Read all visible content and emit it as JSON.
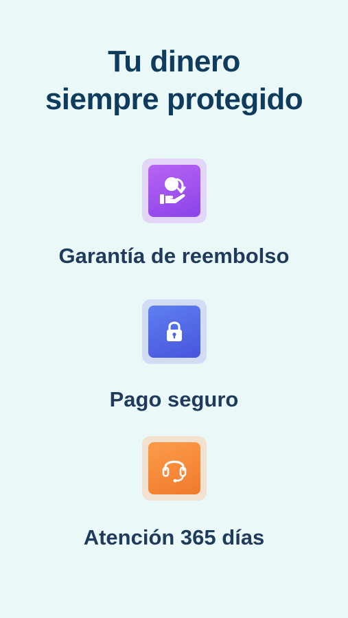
{
  "header": {
    "title_line1": "Tu dinero",
    "title_line2": "siempre protegido"
  },
  "features": [
    {
      "icon": "refund-hand-icon",
      "label": "Garantía de reembolso",
      "accent": "#9b50ee"
    },
    {
      "icon": "lock-icon",
      "label": "Pago seguro",
      "accent": "#4f66e6"
    },
    {
      "icon": "headset-icon",
      "label": "Atención 365 días",
      "accent": "#f5883a"
    }
  ],
  "colors": {
    "background": "#ebf8f8",
    "title": "#0f3c5d",
    "label": "#1f3b5c"
  }
}
